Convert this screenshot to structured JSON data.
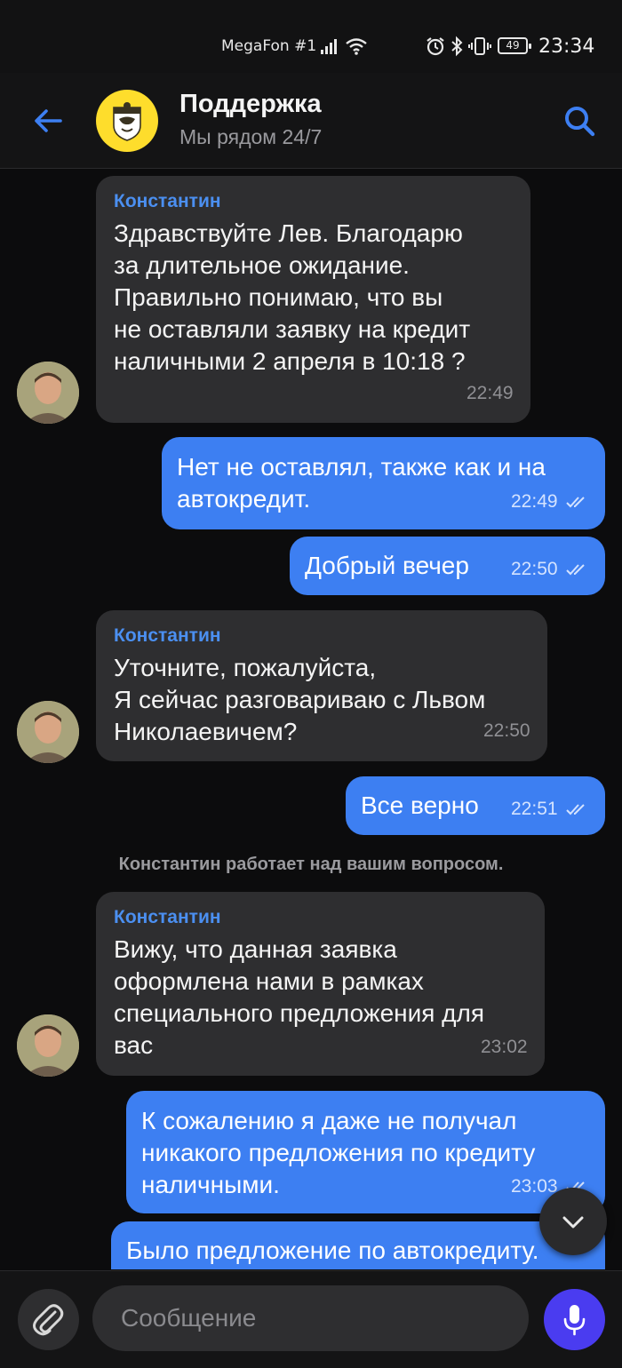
{
  "status_bar": {
    "carrier": "MegaFon #1",
    "battery": "49",
    "time": "23:34"
  },
  "header": {
    "title": "Поддержка",
    "subtitle": "Мы рядом 24/7",
    "back_icon": "arrow-left-icon",
    "search_icon": "search-icon",
    "accent_color": "#3d7ff2"
  },
  "messages": [
    {
      "direction": "in",
      "sender": "Константин",
      "text": "Здравствуйте Лев. Благодарю\nза длительное ожидание.\nПравильно понимаю, что вы\nне оставляли заявку на кредит\nналичными 2 апреля в 10:18 ?",
      "time": "22:49"
    },
    {
      "direction": "out",
      "text": "Нет не оставлял, также как и на\nавтокредит.",
      "time": "22:49"
    },
    {
      "direction": "out",
      "text": "Добрый вечер",
      "time": "22:50"
    },
    {
      "direction": "in",
      "sender": "Константин",
      "text": "Уточните, пожалуйста,\nЯ сейчас разговариваю с Львом\nНиколаевичем?",
      "time": "22:50"
    },
    {
      "direction": "out",
      "text": "Все верно",
      "time": "22:51"
    },
    {
      "direction": "system",
      "text": "Константин работает над вашим вопросом."
    },
    {
      "direction": "in",
      "sender": "Константин",
      "text": "Вижу, что данная заявка\nоформлена нами в рамках\nспециального предложения для\nвас",
      "time": "23:02"
    },
    {
      "direction": "out",
      "text": "К сожалению я даже не получал\nникакого предложения по кредиту\nналичными.",
      "time": "23:03"
    },
    {
      "direction": "out",
      "text": "Было предложение по автокредиту."
    }
  ],
  "composer": {
    "placeholder": "Сообщение",
    "attach_icon": "paperclip-icon",
    "mic_icon": "microphone-icon",
    "mic_color": "#4a3cf0"
  }
}
